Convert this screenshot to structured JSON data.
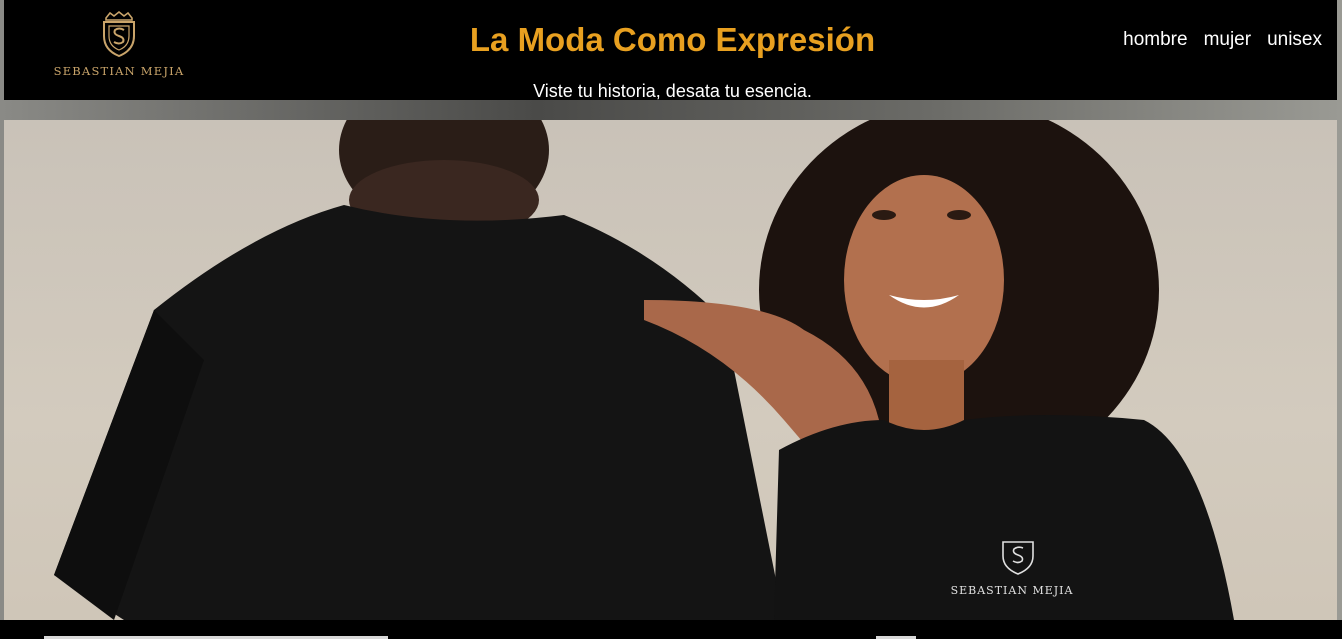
{
  "header": {
    "logo_text": "SEBASTIAN MEJIA",
    "title": "La Moda Como Expresión",
    "tagline": "Viste tu historia, desata tu esencia."
  },
  "nav": {
    "items": [
      {
        "label": "hombre"
      },
      {
        "label": "mujer"
      },
      {
        "label": "unisex"
      }
    ]
  },
  "hero": {
    "shirt_logo_text": "SEBASTIAN MEJIA"
  },
  "colors": {
    "header_bg": "#000000",
    "title": "#e8a020",
    "logo_gold": "#c9a46a",
    "nav_text": "#ffffff"
  }
}
